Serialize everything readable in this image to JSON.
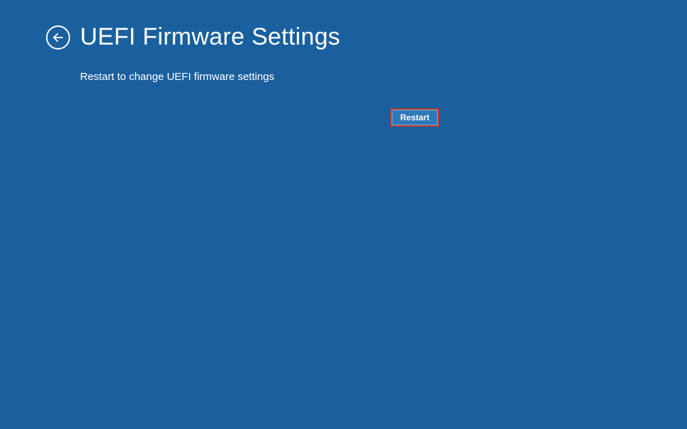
{
  "header": {
    "title": "UEFI Firmware Settings"
  },
  "content": {
    "subtitle": "Restart to change UEFI firmware settings",
    "restart_label": "Restart"
  },
  "colors": {
    "background": "#1a609e",
    "button_bg": "#2f79b8",
    "highlight_border": "#c0392b"
  }
}
